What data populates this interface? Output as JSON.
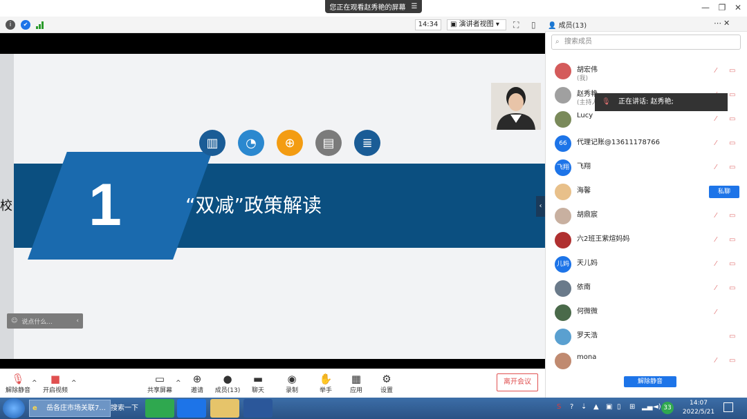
{
  "share_banner": {
    "text": "您正在观看赵秀艳的屏幕",
    "menu_icon": "menu-icon"
  },
  "window": {
    "minimize_icon": "minimize-icon",
    "restore_icon": "restore-icon",
    "close_icon": "close-icon"
  },
  "toolbar": {
    "time": "14:34",
    "view_label": "演讲者视图",
    "info_icon": "info-icon",
    "shield_icon": "shield-icon",
    "signal_icon": "signal-icon"
  },
  "slide": {
    "number": "1",
    "title": "“双减”政策解读",
    "edge_char": "校",
    "chat_placeholder": "说点什么..."
  },
  "bottom_toolbar": {
    "items": [
      "解除静音",
      "开启视频",
      "共享屏幕",
      "邀请",
      "成员(13)",
      "聊天",
      "录制",
      "举手",
      "应用",
      "设置"
    ],
    "leave": "离开会议"
  },
  "panel": {
    "title": "成员(13)",
    "search_placeholder": "搜索成员",
    "speaking_tip": "正在讲话: 赵秀艳;",
    "private_chat": "私聊",
    "unmute_all": "解除静音",
    "members": [
      {
        "name": "胡宏伟",
        "sub": "(我)",
        "avatar": "",
        "color": "#d45b5b"
      },
      {
        "name": "赵秀艳",
        "sub": "(主持人",
        "avatar": "",
        "color": "#a0a0a0"
      },
      {
        "name": "Lucy",
        "sub": "",
        "avatar": "",
        "color": "#7a8a5a"
      },
      {
        "name": "代理记账@13611178766",
        "sub": "",
        "avatar": "66",
        "color": "#1d74e8"
      },
      {
        "name": "飞翔",
        "sub": "",
        "avatar": "飞翔",
        "color": "#1d74e8"
      },
      {
        "name": "海馨",
        "sub": "",
        "avatar": "",
        "color": "#e8c08a"
      },
      {
        "name": "胡鼎宸",
        "sub": "",
        "avatar": "",
        "color": "#c8b0a0"
      },
      {
        "name": "六2班王紫煊妈妈",
        "sub": "",
        "avatar": "",
        "color": "#b03030"
      },
      {
        "name": "天儿妈",
        "sub": "",
        "avatar": "儿妈",
        "color": "#1d74e8"
      },
      {
        "name": "依南",
        "sub": "",
        "avatar": "",
        "color": "#6a7a8a"
      },
      {
        "name": "何微微",
        "sub": "",
        "avatar": "",
        "color": "#4a6a4a"
      },
      {
        "name": "罗天浩",
        "sub": "",
        "avatar": "",
        "color": "#5aa0d0"
      },
      {
        "name": "mona",
        "sub": "",
        "avatar": "",
        "color": "#c08a70"
      }
    ]
  },
  "taskbar": {
    "ie_item": "岳各庄市场关联7...",
    "search": "搜索一下",
    "time": "14:07",
    "date": "2022/5/21",
    "badge": "33"
  }
}
